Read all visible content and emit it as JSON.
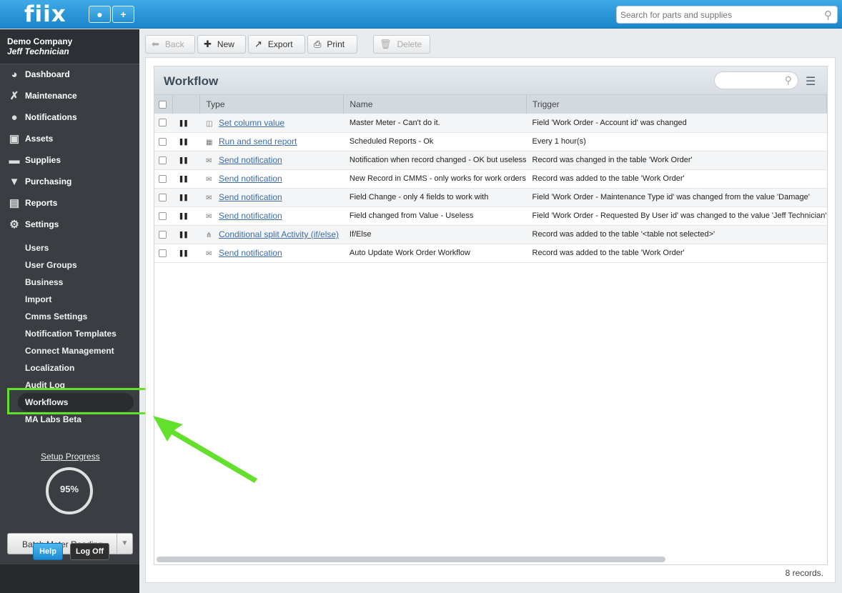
{
  "brand": {
    "logo": "fiix"
  },
  "topbar": {
    "search_placeholder": "Search for parts and supplies"
  },
  "sidebar": {
    "company": "Demo Company",
    "user": "Jeff Technician",
    "nav": [
      {
        "label": "Dashboard",
        "icon": "dashboard-icon"
      },
      {
        "label": "Maintenance",
        "icon": "tools-icon"
      },
      {
        "label": "Notifications",
        "icon": "speech-bubble-icon"
      },
      {
        "label": "Assets",
        "icon": "box-icon"
      },
      {
        "label": "Supplies",
        "icon": "truck-icon"
      },
      {
        "label": "Purchasing",
        "icon": "cart-icon"
      },
      {
        "label": "Reports",
        "icon": "chart-icon"
      },
      {
        "label": "Settings",
        "icon": "gear-icon"
      }
    ],
    "settings_items": [
      "Users",
      "User Groups",
      "Business",
      "Import",
      "Cmms Settings",
      "Notification Templates",
      "Connect Management",
      "Localization",
      "Audit Log",
      "Workflows",
      "MA Labs Beta"
    ],
    "setup_progress_label": "Setup Progress",
    "setup_progress_value": "95%",
    "batch_label": "Batch Meter Reading",
    "help_label": "Help",
    "logoff_label": "Log Off"
  },
  "toolbar": {
    "back": "Back",
    "new": "New",
    "export": "Export",
    "print": "Print",
    "delete": "Delete"
  },
  "workflow": {
    "title": "Workflow",
    "columns": [
      "Type",
      "Name",
      "Trigger"
    ],
    "rows": [
      {
        "type": "Set column value",
        "type_icon": "column-icon",
        "name": "Master Meter - Can't do it.",
        "trigger": "Field 'Work Order - Account id' was changed"
      },
      {
        "type": "Run and send report",
        "type_icon": "report-icon",
        "name": "Scheduled Reports - Ok",
        "trigger": "Every 1 hour(s)"
      },
      {
        "type": "Send notification",
        "type_icon": "envelope-icon",
        "name": "Notification when record changed - OK but useless",
        "trigger": "Record was changed in the table 'Work Order'"
      },
      {
        "type": "Send notification",
        "type_icon": "envelope-icon",
        "name": "New Record in CMMS - only works for work orders",
        "trigger": "Record was added to the table 'Work Order'"
      },
      {
        "type": "Send notification",
        "type_icon": "envelope-icon",
        "name": "Field Change - only 4 fields to work with",
        "trigger": "Field 'Work Order - Maintenance Type id' was changed from the value 'Damage'"
      },
      {
        "type": "Send notification",
        "type_icon": "envelope-icon",
        "name": "Field changed from Value - Useless",
        "trigger": "Field 'Work Order - Requested By User id' was changed to the value 'Jeff Technician'"
      },
      {
        "type": "Conditional split Activity (if/else)",
        "type_icon": "split-icon",
        "name": "If/Else",
        "trigger": "Record was added to the table '<table not selected>'"
      },
      {
        "type": "Send notification",
        "type_icon": "envelope-icon",
        "name": "Auto Update Work Order Workflow",
        "trigger": "Record was added to the table 'Work Order'"
      }
    ],
    "records": "8 records."
  },
  "colors": {
    "accent": "#2b9ad8",
    "highlight": "#63e02b",
    "sidebar": "#3a3e42"
  }
}
